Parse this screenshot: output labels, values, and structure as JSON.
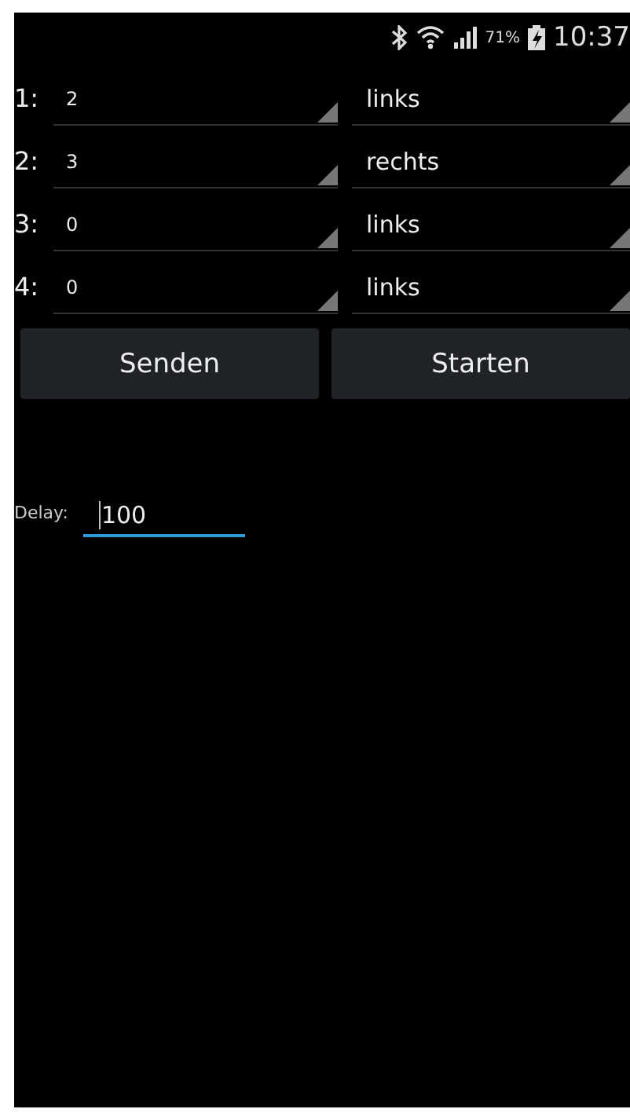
{
  "status_bar": {
    "battery": "71%",
    "time": "10:37"
  },
  "rows": [
    {
      "label": "1:",
      "value": "2",
      "direction": "links"
    },
    {
      "label": "2:",
      "value": "3",
      "direction": "rechts"
    },
    {
      "label": "3:",
      "value": "0",
      "direction": "links"
    },
    {
      "label": "4:",
      "value": "0",
      "direction": "links"
    }
  ],
  "buttons": [
    "Senden",
    "Starten"
  ],
  "delay": {
    "label": "Delay:",
    "value": "100"
  }
}
